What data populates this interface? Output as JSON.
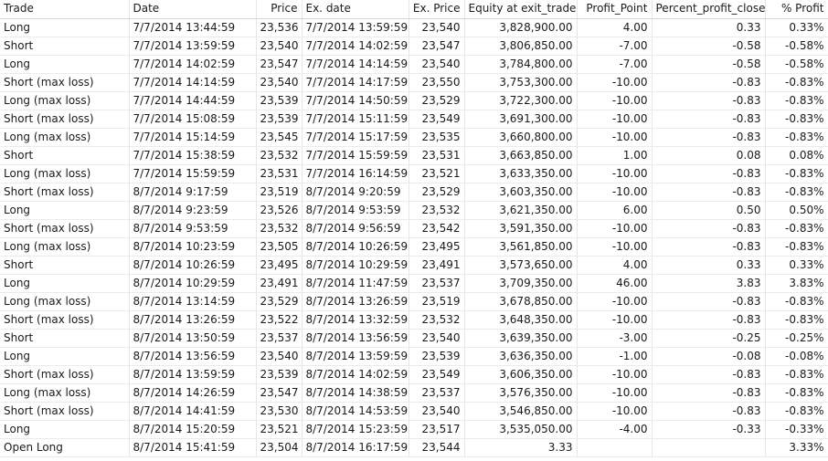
{
  "columns": [
    {
      "key": "trade",
      "label": "Trade",
      "align": "l"
    },
    {
      "key": "date",
      "label": "Date",
      "align": "l"
    },
    {
      "key": "price",
      "label": "Price",
      "align": "r"
    },
    {
      "key": "exdate",
      "label": "Ex. date",
      "align": "l"
    },
    {
      "key": "exprice",
      "label": "Ex. Price",
      "align": "r"
    },
    {
      "key": "equity",
      "label": "Equity at exit_trade",
      "align": "r"
    },
    {
      "key": "point",
      "label": "Profit_Point",
      "align": "r"
    },
    {
      "key": "pct_close",
      "label": "Percent_profit_close",
      "align": "r"
    },
    {
      "key": "pct",
      "label": "% Profit",
      "align": "r"
    }
  ],
  "rows": [
    {
      "trade": "Long",
      "date": "7/7/2014 13:44:59",
      "price": "23,536",
      "exdate": "7/7/2014 13:59:59",
      "exprice": "23,540",
      "equity": "3,828,900.00",
      "point": "4.00",
      "pct_close": "0.33",
      "pct": "0.33%"
    },
    {
      "trade": "Short",
      "date": "7/7/2014 13:59:59",
      "price": "23,540",
      "exdate": "7/7/2014 14:02:59",
      "exprice": "23,547",
      "equity": "3,806,850.00",
      "point": "-7.00",
      "pct_close": "-0.58",
      "pct": "-0.58%"
    },
    {
      "trade": "Long",
      "date": "7/7/2014 14:02:59",
      "price": "23,547",
      "exdate": "7/7/2014 14:14:59",
      "exprice": "23,540",
      "equity": "3,784,800.00",
      "point": "-7.00",
      "pct_close": "-0.58",
      "pct": "-0.58%"
    },
    {
      "trade": "Short (max loss)",
      "date": "7/7/2014 14:14:59",
      "price": "23,540",
      "exdate": "7/7/2014 14:17:59",
      "exprice": "23,550",
      "equity": "3,753,300.00",
      "point": "-10.00",
      "pct_close": "-0.83",
      "pct": "-0.83%"
    },
    {
      "trade": "Long (max loss)",
      "date": "7/7/2014 14:44:59",
      "price": "23,539",
      "exdate": "7/7/2014 14:50:59",
      "exprice": "23,529",
      "equity": "3,722,300.00",
      "point": "-10.00",
      "pct_close": "-0.83",
      "pct": "-0.83%"
    },
    {
      "trade": "Short (max loss)",
      "date": "7/7/2014 15:08:59",
      "price": "23,539",
      "exdate": "7/7/2014 15:11:59",
      "exprice": "23,549",
      "equity": "3,691,300.00",
      "point": "-10.00",
      "pct_close": "-0.83",
      "pct": "-0.83%"
    },
    {
      "trade": "Long (max loss)",
      "date": "7/7/2014 15:14:59",
      "price": "23,545",
      "exdate": "7/7/2014 15:17:59",
      "exprice": "23,535",
      "equity": "3,660,800.00",
      "point": "-10.00",
      "pct_close": "-0.83",
      "pct": "-0.83%"
    },
    {
      "trade": "Short",
      "date": "7/7/2014 15:38:59",
      "price": "23,532",
      "exdate": "7/7/2014 15:59:59",
      "exprice": "23,531",
      "equity": "3,663,850.00",
      "point": "1.00",
      "pct_close": "0.08",
      "pct": "0.08%"
    },
    {
      "trade": "Long (max loss)",
      "date": "7/7/2014 15:59:59",
      "price": "23,531",
      "exdate": "7/7/2014 16:14:59",
      "exprice": "23,521",
      "equity": "3,633,350.00",
      "point": "-10.00",
      "pct_close": "-0.83",
      "pct": "-0.83%"
    },
    {
      "trade": "Short (max loss)",
      "date": "8/7/2014 9:17:59",
      "price": "23,519",
      "exdate": "8/7/2014 9:20:59",
      "exprice": "23,529",
      "equity": "3,603,350.00",
      "point": "-10.00",
      "pct_close": "-0.83",
      "pct": "-0.83%"
    },
    {
      "trade": "Long",
      "date": "8/7/2014 9:23:59",
      "price": "23,526",
      "exdate": "8/7/2014 9:53:59",
      "exprice": "23,532",
      "equity": "3,621,350.00",
      "point": "6.00",
      "pct_close": "0.50",
      "pct": "0.50%"
    },
    {
      "trade": "Short (max loss)",
      "date": "8/7/2014 9:53:59",
      "price": "23,532",
      "exdate": "8/7/2014 9:56:59",
      "exprice": "23,542",
      "equity": "3,591,350.00",
      "point": "-10.00",
      "pct_close": "-0.83",
      "pct": "-0.83%"
    },
    {
      "trade": "Long (max loss)",
      "date": "8/7/2014 10:23:59",
      "price": "23,505",
      "exdate": "8/7/2014 10:26:59",
      "exprice": "23,495",
      "equity": "3,561,850.00",
      "point": "-10.00",
      "pct_close": "-0.83",
      "pct": "-0.83%"
    },
    {
      "trade": "Short",
      "date": "8/7/2014 10:26:59",
      "price": "23,495",
      "exdate": "8/7/2014 10:29:59",
      "exprice": "23,491",
      "equity": "3,573,650.00",
      "point": "4.00",
      "pct_close": "0.33",
      "pct": "0.33%"
    },
    {
      "trade": "Long",
      "date": "8/7/2014 10:29:59",
      "price": "23,491",
      "exdate": "8/7/2014 11:47:59",
      "exprice": "23,537",
      "equity": "3,709,350.00",
      "point": "46.00",
      "pct_close": "3.83",
      "pct": "3.83%"
    },
    {
      "trade": "Long (max loss)",
      "date": "8/7/2014 13:14:59",
      "price": "23,529",
      "exdate": "8/7/2014 13:26:59",
      "exprice": "23,519",
      "equity": "3,678,850.00",
      "point": "-10.00",
      "pct_close": "-0.83",
      "pct": "-0.83%"
    },
    {
      "trade": "Short (max loss)",
      "date": "8/7/2014 13:26:59",
      "price": "23,522",
      "exdate": "8/7/2014 13:32:59",
      "exprice": "23,532",
      "equity": "3,648,350.00",
      "point": "-10.00",
      "pct_close": "-0.83",
      "pct": "-0.83%"
    },
    {
      "trade": "Short",
      "date": "8/7/2014 13:50:59",
      "price": "23,537",
      "exdate": "8/7/2014 13:56:59",
      "exprice": "23,540",
      "equity": "3,639,350.00",
      "point": "-3.00",
      "pct_close": "-0.25",
      "pct": "-0.25%"
    },
    {
      "trade": "Long",
      "date": "8/7/2014 13:56:59",
      "price": "23,540",
      "exdate": "8/7/2014 13:59:59",
      "exprice": "23,539",
      "equity": "3,636,350.00",
      "point": "-1.00",
      "pct_close": "-0.08",
      "pct": "-0.08%"
    },
    {
      "trade": "Short (max loss)",
      "date": "8/7/2014 13:59:59",
      "price": "23,539",
      "exdate": "8/7/2014 14:02:59",
      "exprice": "23,549",
      "equity": "3,606,350.00",
      "point": "-10.00",
      "pct_close": "-0.83",
      "pct": "-0.83%"
    },
    {
      "trade": "Long (max loss)",
      "date": "8/7/2014 14:26:59",
      "price": "23,547",
      "exdate": "8/7/2014 14:38:59",
      "exprice": "23,537",
      "equity": "3,576,350.00",
      "point": "-10.00",
      "pct_close": "-0.83",
      "pct": "-0.83%"
    },
    {
      "trade": "Short (max loss)",
      "date": "8/7/2014 14:41:59",
      "price": "23,530",
      "exdate": "8/7/2014 14:53:59",
      "exprice": "23,540",
      "equity": "3,546,850.00",
      "point": "-10.00",
      "pct_close": "-0.83",
      "pct": "-0.83%"
    },
    {
      "trade": "Long",
      "date": "8/7/2014 15:20:59",
      "price": "23,521",
      "exdate": "8/7/2014 15:23:59",
      "exprice": "23,517",
      "equity": "3,535,050.00",
      "point": "-4.00",
      "pct_close": "-0.33",
      "pct": "-0.33%"
    },
    {
      "trade": "Open Long",
      "date": "8/7/2014 15:41:59",
      "price": "23,504",
      "exdate": "8/7/2014 16:17:59",
      "exprice": "23,544",
      "equity": "3.33",
      "point": "",
      "pct_close": "",
      "pct": "3.33%"
    }
  ]
}
